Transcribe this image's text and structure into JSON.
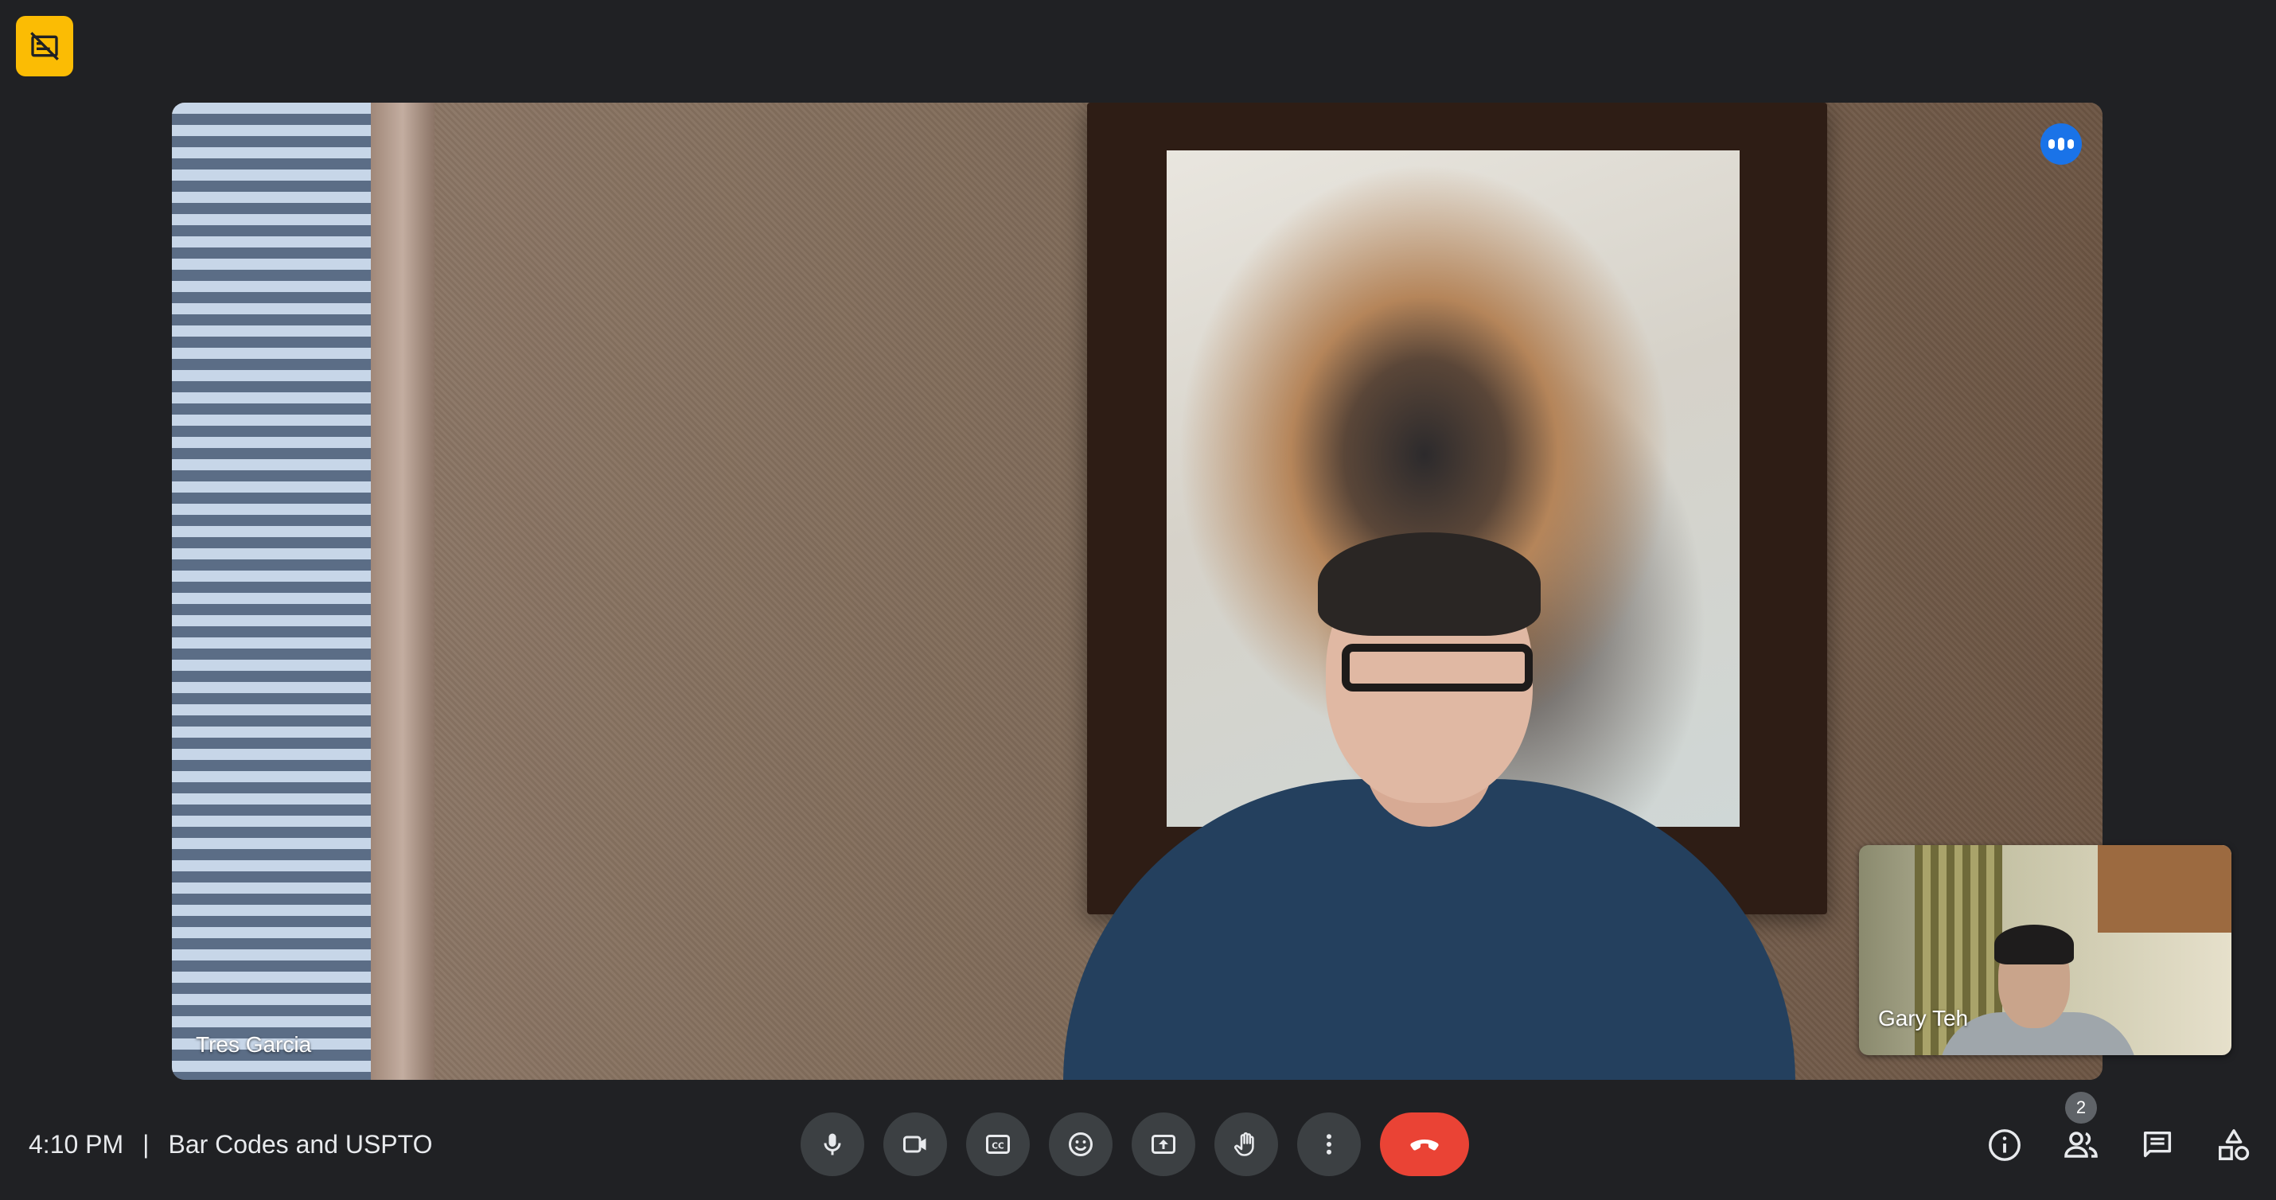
{
  "meeting": {
    "time": "4:10 PM",
    "separator": "|",
    "title": "Bar Codes and USPTO"
  },
  "participants": {
    "main_speaker": "Tres Garcia",
    "self_view": "Gary Teh",
    "count": "2"
  },
  "icons": {
    "top_left": "captions-off-icon",
    "speaking": "audio-indicator-icon",
    "controls": [
      "mic-icon",
      "camera-icon",
      "closed-captions-icon",
      "emoji-icon",
      "present-screen-icon",
      "raise-hand-icon",
      "more-options-icon",
      "end-call-icon"
    ],
    "side": [
      "info-icon",
      "people-icon",
      "chat-icon",
      "activities-icon"
    ]
  },
  "colors": {
    "background": "#202124",
    "control_button": "#3c4043",
    "end_call": "#ea4335",
    "badge_yellow": "#fbbc04",
    "speaking_blue": "#1a73e8"
  }
}
